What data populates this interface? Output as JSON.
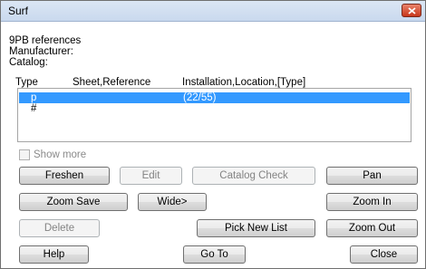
{
  "window": {
    "title": "Surf"
  },
  "info": {
    "line1": "9PB references",
    "line2": "Manufacturer:",
    "line3": "Catalog:"
  },
  "list": {
    "columns": [
      "Type",
      "Sheet,Reference",
      "Installation,Location,[Type]"
    ],
    "rows": [
      {
        "type": "p",
        "reference": "",
        "installation": "(22/55)",
        "selected": true
      },
      {
        "type": "#",
        "reference": "",
        "installation": "",
        "selected": false
      }
    ]
  },
  "show_more": {
    "label": "Show more",
    "checked": false
  },
  "buttons": {
    "freshen": "Freshen",
    "edit": "Edit",
    "catalog_check": "Catalog Check",
    "pan": "Pan",
    "zoom_save": "Zoom Save",
    "wide": "Wide>",
    "zoom_in": "Zoom In",
    "delete": "Delete",
    "pick_new_list": "Pick New List",
    "zoom_out": "Zoom Out",
    "help": "Help",
    "go_to": "Go To",
    "close": "Close"
  }
}
